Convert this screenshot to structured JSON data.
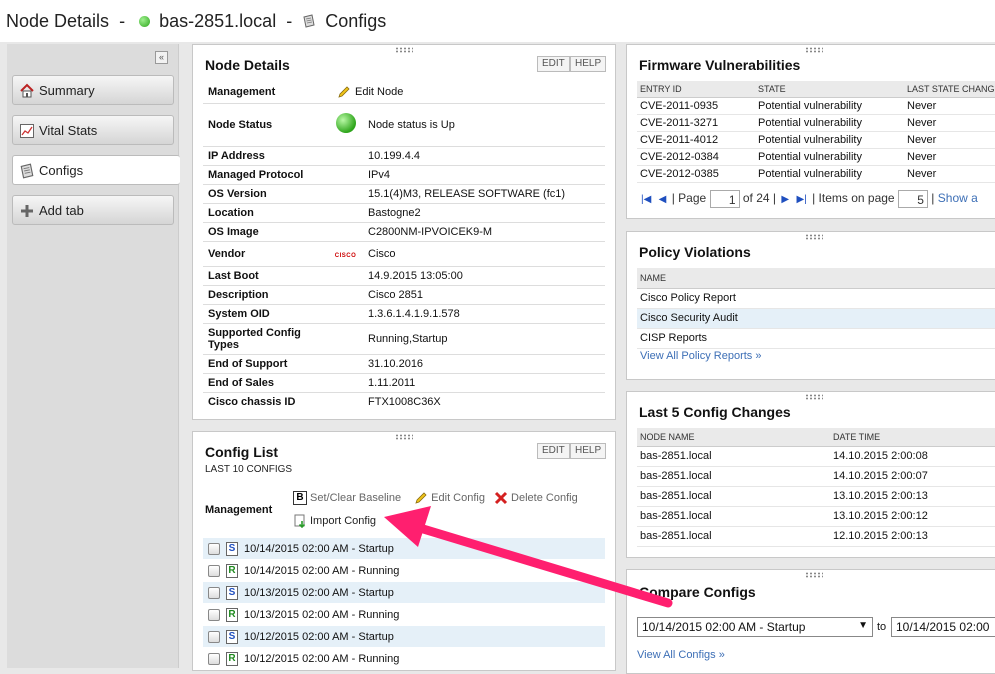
{
  "header": {
    "title": "Node Details",
    "sep1": "-",
    "node": "bas-2851.local",
    "sep2": "-",
    "section": "Configs"
  },
  "sidebar": {
    "collapse": "«",
    "tabs": [
      {
        "label": "Summary"
      },
      {
        "label": "Vital Stats"
      },
      {
        "label": "Configs"
      },
      {
        "label": "Add tab"
      }
    ]
  },
  "node_details": {
    "title": "Node Details",
    "edit": "EDIT",
    "help": "HELP",
    "rows": [
      {
        "key": "Management",
        "value": "Edit Node"
      },
      {
        "key": "Node Status",
        "value": "Node status is Up"
      },
      {
        "key": "IP Address",
        "value": "10.199.4.4"
      },
      {
        "key": "Managed Protocol",
        "value": "IPv4"
      },
      {
        "key": "OS Version",
        "value": "15.1(4)M3, RELEASE SOFTWARE (fc1)"
      },
      {
        "key": "Location",
        "value": "Bastogne2"
      },
      {
        "key": "OS Image",
        "value": "C2800NM-IPVOICEK9-M"
      },
      {
        "key": "Vendor",
        "value": "Cisco",
        "icon": "CISCO"
      },
      {
        "key": "Last Boot",
        "value": "14.9.2015 13:05:00"
      },
      {
        "key": "Description",
        "value": "Cisco 2851"
      },
      {
        "key": "System OID",
        "value": "1.3.6.1.4.1.9.1.578"
      },
      {
        "key": "Supported Config Types",
        "value": "Running,Startup"
      },
      {
        "key": "End of Support",
        "value": "31.10.2016"
      },
      {
        "key": "End of Sales",
        "value": "1.11.2011"
      },
      {
        "key": "Cisco chassis ID",
        "value": "FTX1008C36X"
      }
    ]
  },
  "config_list": {
    "title": "Config List",
    "subtitle": "LAST 10 CONFIGS",
    "edit": "EDIT",
    "help": "HELP",
    "management_label": "Management",
    "actions": {
      "baseline": "Set/Clear Baseline",
      "edit": "Edit Config",
      "delete": "Delete Config",
      "import": "Import Config"
    },
    "rows": [
      {
        "type": "S",
        "label": "10/14/2015 02:00 AM - Startup"
      },
      {
        "type": "R",
        "label": "10/14/2015 02:00 AM - Running"
      },
      {
        "type": "S",
        "label": "10/13/2015 02:00 AM - Startup"
      },
      {
        "type": "R",
        "label": "10/13/2015 02:00 AM - Running"
      },
      {
        "type": "S",
        "label": "10/12/2015 02:00 AM - Startup"
      },
      {
        "type": "R",
        "label": "10/12/2015 02:00 AM - Running"
      }
    ]
  },
  "firmware": {
    "title": "Firmware Vulnerabilities",
    "columns": [
      "ENTRY ID",
      "STATE",
      "LAST STATE CHANG"
    ],
    "rows": [
      [
        "CVE-2011-0935",
        "Potential vulnerability",
        "Never"
      ],
      [
        "CVE-2011-3271",
        "Potential vulnerability",
        "Never"
      ],
      [
        "CVE-2011-4012",
        "Potential vulnerability",
        "Never"
      ],
      [
        "CVE-2012-0384",
        "Potential vulnerability",
        "Never"
      ],
      [
        "CVE-2012-0385",
        "Potential vulnerability",
        "Never"
      ]
    ],
    "pager": {
      "page_label": "Page",
      "page": "1",
      "of": "of 24",
      "items_label": "Items on page",
      "items": "5",
      "show_all": "Show a"
    }
  },
  "policy": {
    "title": "Policy Violations",
    "column": "NAME",
    "rows": [
      "Cisco Policy Report",
      "Cisco Security Audit",
      "CISP Reports"
    ],
    "link": "View All Policy Reports »"
  },
  "last_changes": {
    "title": "Last 5 Config Changes",
    "columns": [
      "NODE NAME",
      "DATE TIME"
    ],
    "rows": [
      [
        "bas-2851.local",
        "14.10.2015 2:00:08"
      ],
      [
        "bas-2851.local",
        "14.10.2015 2:00:07"
      ],
      [
        "bas-2851.local",
        "13.10.2015 2:00:13"
      ],
      [
        "bas-2851.local",
        "13.10.2015 2:00:12"
      ],
      [
        "bas-2851.local",
        "12.10.2015 2:00:13"
      ]
    ]
  },
  "compare": {
    "title": "Compare Configs",
    "left": "10/14/2015 02:00 AM - Startup",
    "to": "to",
    "right": "10/14/2015 02:00",
    "link": "View All Configs »"
  },
  "colors": {
    "accent": "#3d6fb6",
    "highlight": "#e5f0f8",
    "arrow": "#ff1f6f",
    "status_up": "#2da51c"
  }
}
